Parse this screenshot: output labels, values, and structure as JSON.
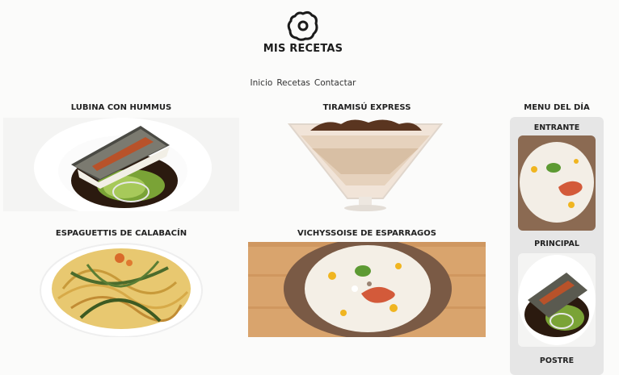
{
  "site": {
    "title": "MIS RECETAS",
    "logo_icon": "fried-egg-icon"
  },
  "nav": {
    "items": [
      {
        "label": "Inicio"
      },
      {
        "label": "Recetas"
      },
      {
        "label": "Contactar"
      }
    ]
  },
  "recipes": [
    {
      "title": "LUBINA CON HUMMUS"
    },
    {
      "title": "TIRAMISÚ EXPRESS"
    },
    {
      "title": "ESPAGUETTIS DE CALABACÍN"
    },
    {
      "title": "VICHYSSOISE DE ESPARRAGOS"
    }
  ],
  "sidebar": {
    "title": "MENU DEL DÍA",
    "sections": [
      {
        "label": "ENTRANTE"
      },
      {
        "label": "PRINCIPAL"
      },
      {
        "label": "POSTRE"
      }
    ]
  },
  "colors": {
    "background": "#fbfbfa",
    "sidebar": "#e6e6e6"
  }
}
